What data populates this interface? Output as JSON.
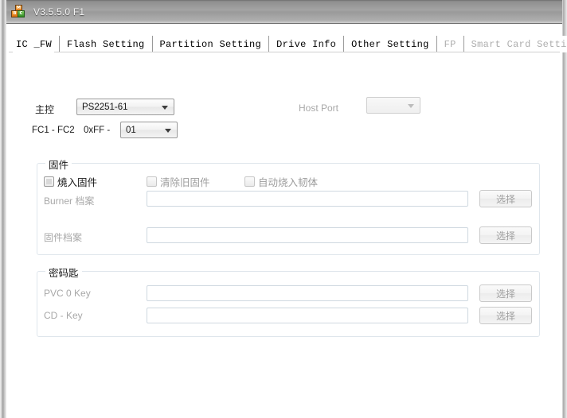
{
  "window": {
    "title": "V3.5.5.0 F1",
    "icon": "app-blocks-icon"
  },
  "tabs": [
    {
      "label": "IC _FW",
      "active": true,
      "disabled": false
    },
    {
      "label": "Flash Setting",
      "active": false,
      "disabled": false
    },
    {
      "label": "Partition Setting",
      "active": false,
      "disabled": false
    },
    {
      "label": "Drive Info",
      "active": false,
      "disabled": false
    },
    {
      "label": "Other Setting",
      "active": false,
      "disabled": false
    },
    {
      "label": "FP",
      "active": false,
      "disabled": true
    },
    {
      "label": "Smart Card Setting",
      "active": false,
      "disabled": true
    }
  ],
  "controller": {
    "label": "主控",
    "value": "PS2251-61"
  },
  "host_port": {
    "label": "Host Port",
    "value": ""
  },
  "fc_range": {
    "label": "FC1 - FC2",
    "prefix": "0xFF -",
    "value": "01"
  },
  "firmware_group": {
    "title": "固件",
    "checkboxes": [
      {
        "label": "燒入固件",
        "checked": false,
        "disabled": false
      },
      {
        "label": "清除旧固件",
        "checked": false,
        "disabled": true
      },
      {
        "label": "自动烧入韧体",
        "checked": false,
        "disabled": true
      }
    ],
    "fields": [
      {
        "label": "Burner 档案",
        "value": "",
        "button": "选择"
      },
      {
        "label": "固件档案",
        "value": "",
        "button": "选择"
      }
    ]
  },
  "key_group": {
    "title": "密码匙",
    "fields": [
      {
        "label": "PVC 0 Key",
        "value": "",
        "button": "选择"
      },
      {
        "label": "CD - Key",
        "value": "",
        "button": "选择"
      }
    ]
  },
  "colors": {
    "titlebar_text": "#f4f4f4",
    "label_text": "#1a1a1a",
    "disabled_text": "#a8a8a8",
    "group_border": "#dfe6ec",
    "field_border": "#cfd8e0"
  }
}
